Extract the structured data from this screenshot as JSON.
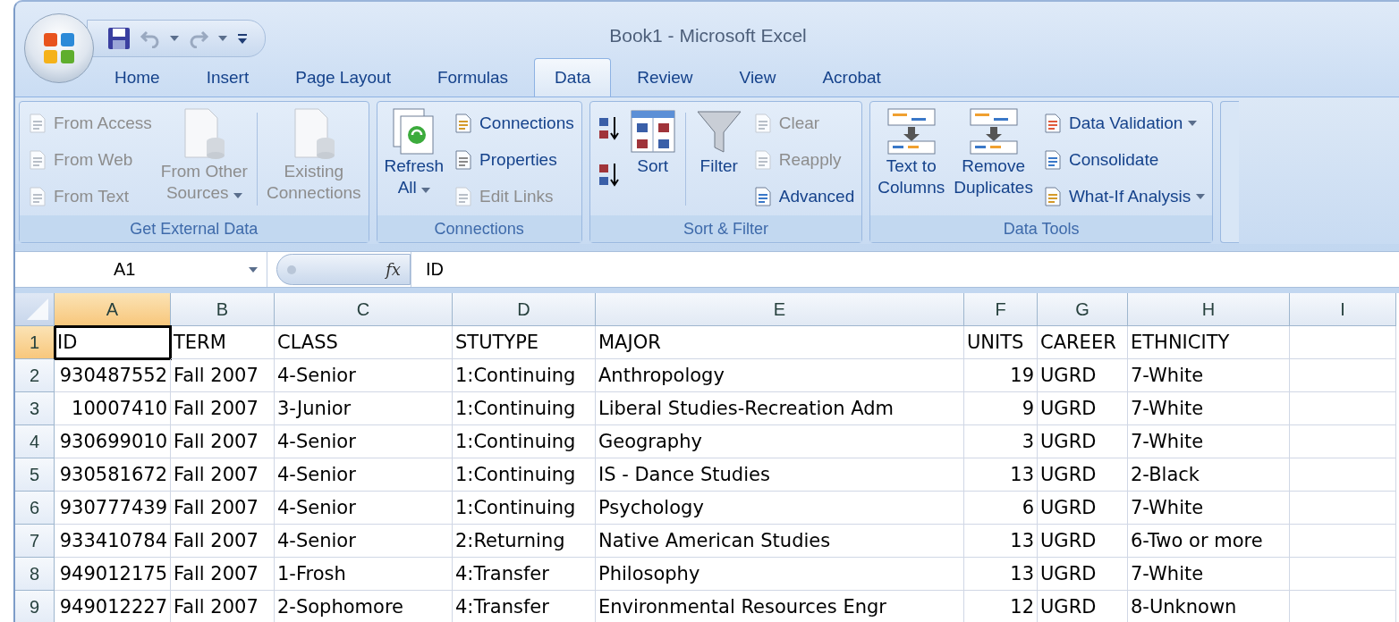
{
  "window": {
    "title": "Book1 - Microsoft Excel"
  },
  "tabs": [
    {
      "label": "Home",
      "selected": false
    },
    {
      "label": "Insert",
      "selected": false
    },
    {
      "label": "Page Layout",
      "selected": false
    },
    {
      "label": "Formulas",
      "selected": false
    },
    {
      "label": "Data",
      "selected": true
    },
    {
      "label": "Review",
      "selected": false
    },
    {
      "label": "View",
      "selected": false
    },
    {
      "label": "Acrobat",
      "selected": false
    }
  ],
  "ribbon_groups": [
    {
      "title": "Get External Data",
      "items": [
        {
          "kind": "stack",
          "items": [
            {
              "label": "From Access",
              "disabled": true
            },
            {
              "label": "From Web",
              "disabled": true
            },
            {
              "label": "From Text",
              "disabled": true
            }
          ]
        },
        {
          "kind": "large",
          "label": "From Other",
          "label_2": "Sources",
          "dropdown": true,
          "disabled": true
        },
        {
          "kind": "separator"
        },
        {
          "kind": "large",
          "label": "Existing",
          "label_2": "Connections",
          "disabled": true
        }
      ]
    },
    {
      "title": "Connections",
      "items": [
        {
          "kind": "large",
          "label": "Refresh",
          "label_2": "All",
          "dropdown": true,
          "disabled": false
        },
        {
          "kind": "stack",
          "items": [
            {
              "label": "Connections",
              "disabled": false
            },
            {
              "label": "Properties",
              "disabled": false
            },
            {
              "label": "Edit Links",
              "disabled": true
            }
          ]
        }
      ]
    },
    {
      "title": "Sort & Filter",
      "items": [
        {
          "kind": "sortstack"
        },
        {
          "kind": "large",
          "label": "Sort",
          "disabled": false
        },
        {
          "kind": "separator"
        },
        {
          "kind": "large",
          "label": "Filter",
          "disabled": false
        },
        {
          "kind": "stack",
          "items": [
            {
              "label": "Clear",
              "disabled": true
            },
            {
              "label": "Reapply",
              "disabled": true
            },
            {
              "label": "Advanced",
              "disabled": false
            }
          ]
        }
      ]
    },
    {
      "title": "Data Tools",
      "items": [
        {
          "kind": "large",
          "label": "Text to",
          "label_2": "Columns",
          "disabled": false
        },
        {
          "kind": "large",
          "label": "Remove",
          "label_2": "Duplicates",
          "disabled": false
        },
        {
          "kind": "stack",
          "items": [
            {
              "label": "Data Validation",
              "disabled": false,
              "dropdown": true
            },
            {
              "label": "Consolidate",
              "disabled": false
            },
            {
              "label": "What-If Analysis",
              "disabled": false,
              "dropdown": true
            }
          ]
        }
      ]
    }
  ],
  "formula_bar": {
    "name_box": "A1",
    "function_label": "fx",
    "value": "ID"
  },
  "sheet": {
    "columns": [
      {
        "label": "A",
        "kind": "number",
        "selected": true
      },
      {
        "label": "B",
        "kind": "text",
        "selected": false
      },
      {
        "label": "C",
        "kind": "text",
        "selected": false
      },
      {
        "label": "D",
        "kind": "text",
        "selected": false
      },
      {
        "label": "E",
        "kind": "text",
        "selected": false
      },
      {
        "label": "F",
        "kind": "number",
        "selected": false
      },
      {
        "label": "G",
        "kind": "text",
        "selected": false
      },
      {
        "label": "H",
        "kind": "text",
        "selected": false
      },
      {
        "label": "I",
        "kind": "text",
        "selected": false
      }
    ],
    "rows": [
      {
        "number": "1",
        "kind": "header",
        "selected": true,
        "cells": [
          "ID",
          "TERM",
          "CLASS",
          "STUTYPE",
          "MAJOR",
          "UNITS",
          "CAREER",
          "ETHNICITY"
        ]
      },
      {
        "number": "2",
        "kind": "data",
        "selected": false,
        "cells": [
          "930487552",
          "Fall 2007",
          "4-Senior",
          "1:Continuing",
          "Anthropology",
          "19",
          "UGRD",
          "7-White"
        ]
      },
      {
        "number": "3",
        "kind": "data",
        "selected": false,
        "cells": [
          "10007410",
          "Fall 2007",
          "3-Junior",
          "1:Continuing",
          "Liberal Studies-Recreation Adm",
          "9",
          "UGRD",
          "7-White"
        ]
      },
      {
        "number": "4",
        "kind": "data",
        "selected": false,
        "cells": [
          "930699010",
          "Fall 2007",
          "4-Senior",
          "1:Continuing",
          "Geography",
          "3",
          "UGRD",
          "7-White"
        ]
      },
      {
        "number": "5",
        "kind": "data",
        "selected": false,
        "cells": [
          "930581672",
          "Fall 2007",
          "4-Senior",
          "1:Continuing",
          "IS - Dance Studies",
          "13",
          "UGRD",
          "2-Black"
        ]
      },
      {
        "number": "6",
        "kind": "data",
        "selected": false,
        "cells": [
          "930777439",
          "Fall 2007",
          "4-Senior",
          "1:Continuing",
          "Psychology",
          "6",
          "UGRD",
          "7-White"
        ]
      },
      {
        "number": "7",
        "kind": "data",
        "selected": false,
        "cells": [
          "933410784",
          "Fall 2007",
          "4-Senior",
          "2:Returning",
          "Native American Studies",
          "13",
          "UGRD",
          "6-Two or more"
        ]
      },
      {
        "number": "8",
        "kind": "data",
        "selected": false,
        "cells": [
          "949012175",
          "Fall 2007",
          "1-Frosh",
          "4:Transfer",
          "Philosophy",
          "13",
          "UGRD",
          "7-White"
        ]
      },
      {
        "number": "9",
        "kind": "data",
        "selected": false,
        "cells": [
          "949012227",
          "Fall 2007",
          "2-Sophomore",
          "4:Transfer",
          "Environmental Resources Engr",
          "12",
          "UGRD",
          "8-Unknown"
        ]
      }
    ]
  }
}
